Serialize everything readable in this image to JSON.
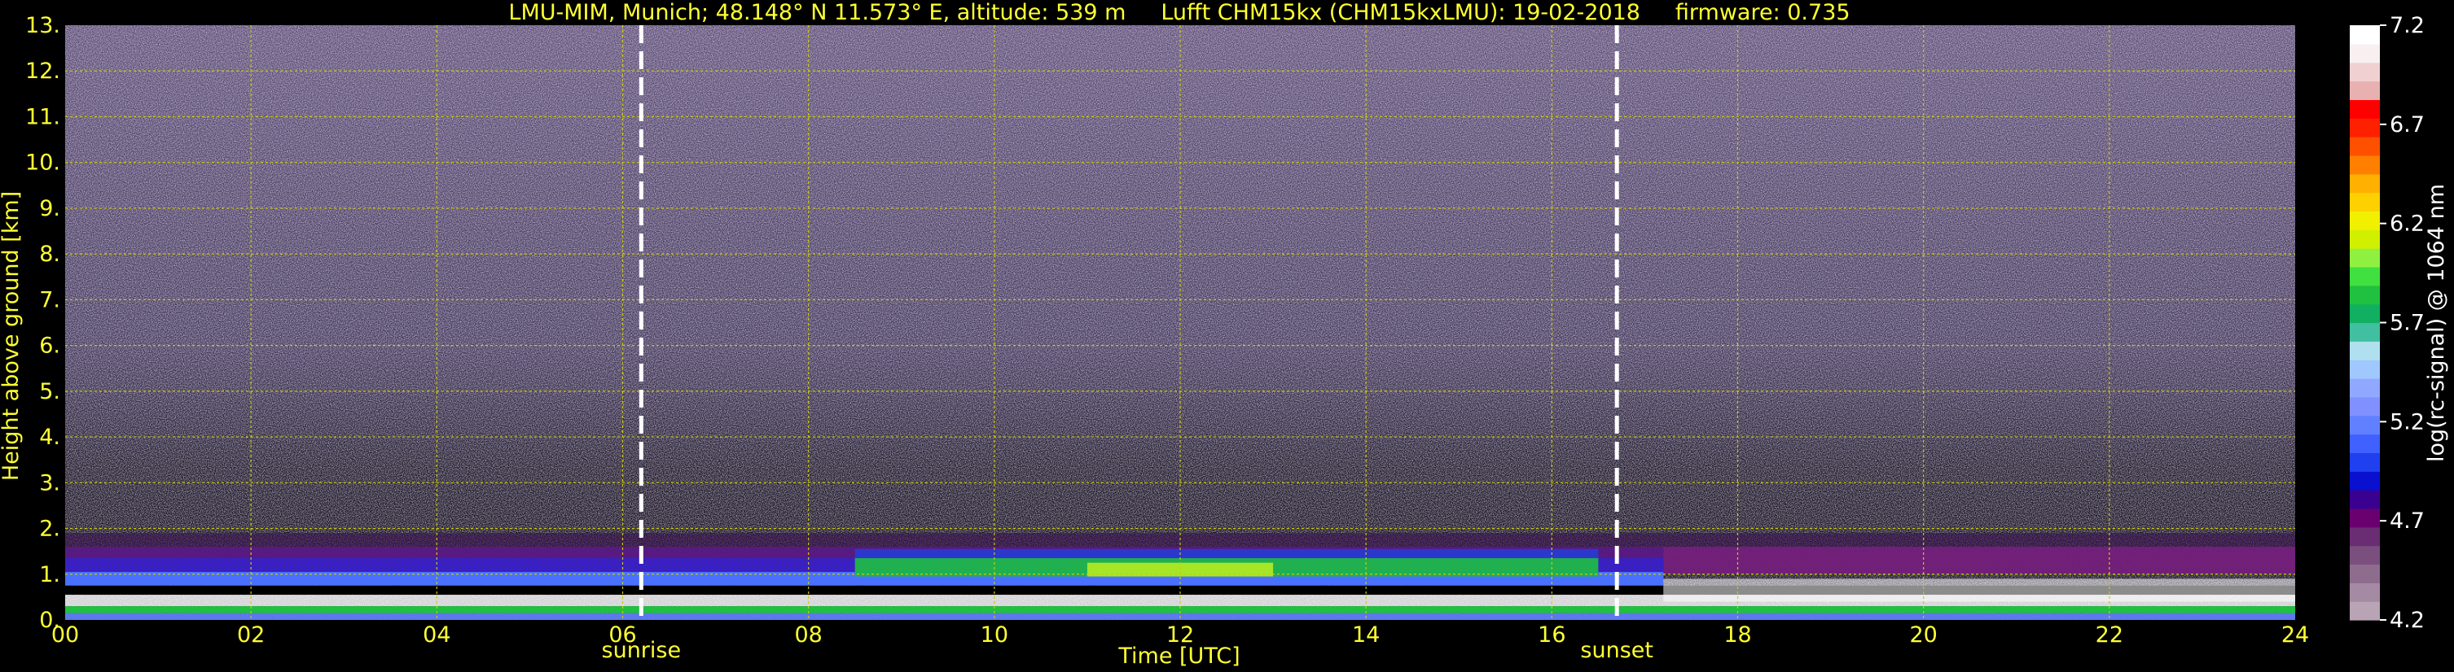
{
  "chart_data": {
    "type": "heatmap",
    "title": "LMU-MIM, Munich; 48.148° N 11.573° E, altitude: 539 m     Lufft CHM15kx (CHM15kxLMU): 19-02-2018     firmware: 0.735",
    "xlabel": "Time [UTC]",
    "ylabel": "Height above ground [km]",
    "colorbar_label": "log(rc-signal) @ 1064 nm",
    "xlim": [
      0,
      24
    ],
    "ylim": [
      0,
      13
    ],
    "x_ticks": [
      "00",
      "02",
      "04",
      "06",
      "08",
      "10",
      "12",
      "14",
      "16",
      "18",
      "20",
      "22",
      "24"
    ],
    "y_ticks": [
      "0.",
      "1.",
      "2.",
      "3.",
      "4.",
      "5.",
      "6.",
      "7.",
      "8.",
      "9.",
      "10.",
      "11.",
      "12.",
      "13."
    ],
    "colorbar_range": [
      4.2,
      7.2
    ],
    "colorbar_ticks": [
      "4.2",
      "4.7",
      "5.2",
      "5.7",
      "6.2",
      "6.7",
      "7.2"
    ],
    "grid": true,
    "events": [
      {
        "label": "sunrise",
        "time": 6.2
      },
      {
        "label": "sunset",
        "time": 16.7
      }
    ],
    "colors": {
      "text": "#ffff33",
      "grid": "#cccc00",
      "background": "#000000",
      "event_line": "#ffffff"
    },
    "colormap": [
      "#b8a4b4",
      "#a58aa3",
      "#8e6c8e",
      "#7a4f7e",
      "#6a2c72",
      "#6a0070",
      "#3a0090",
      "#0a10d0",
      "#2040f0",
      "#4060ff",
      "#6080ff",
      "#8090ff",
      "#90a8ff",
      "#a0c8ff",
      "#b0e0f0",
      "#40c0a0",
      "#10b060",
      "#20c040",
      "#40e040",
      "#90f040",
      "#d0f000",
      "#f0f000",
      "#ffd000",
      "#ffb000",
      "#ff8000",
      "#ff5000",
      "#ff2000",
      "#ff0000",
      "#e8b0b0",
      "#f0d0d0",
      "#f8f0f0",
      "#ffffff"
    ]
  }
}
